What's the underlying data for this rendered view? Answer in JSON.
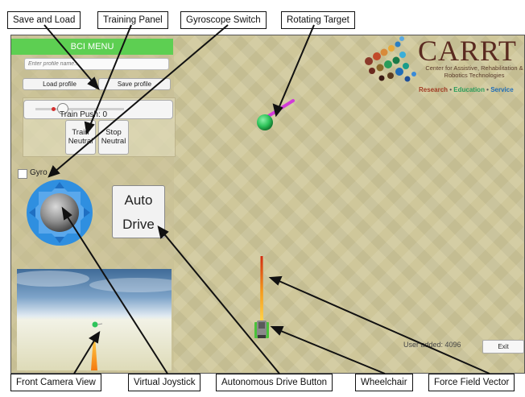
{
  "menu": {
    "title": "BCI MENU"
  },
  "profile": {
    "placeholder": "Enter profile name...",
    "load_label": "Load profile",
    "save_label": "Save profile"
  },
  "training": {
    "push_label": "Train Push: 0",
    "train_neutral_label": "Train\nNeutral",
    "stop_neutral_label": "Stop\nNeutral",
    "slider_value": 0.06
  },
  "gyro": {
    "label": "Gyro",
    "checked": false
  },
  "auto_drive": {
    "line1": "Auto",
    "line2": "Drive"
  },
  "logo": {
    "name": "CARRT",
    "subtitle": "Center for Assistive, Rehabilitation & Robotics Technologies",
    "tag_research": "Research",
    "tag_education": "Education",
    "tag_service": "Service",
    "tag_sep": " • ",
    "colors": {
      "research": "#a23b24",
      "education": "#2a9c5a",
      "service": "#1f6db8"
    }
  },
  "status": {
    "user_added": "User added: 4096"
  },
  "exit": {
    "label": "Exit"
  },
  "callouts": {
    "save_and_load": "Save and Load",
    "training_panel": "Training Panel",
    "gyroscope_switch": "Gyroscope Switch",
    "rotating_target": "Rotating Target",
    "front_camera_view": "Front Camera View",
    "virtual_joystick": "Virtual Joystick",
    "autonomous_drive_button": "Autonomous Drive Button",
    "wheelchair": "Wheelchair",
    "force_field_vector": "Force Field Vector"
  },
  "colors": {
    "menu_green": "#5dcf52",
    "joystick_blue": "#2f8fe0",
    "target_green": "#2ec45a",
    "target_vector": "#d23ad9"
  },
  "icons": [
    "joystick-icon",
    "target-sphere-icon",
    "wheelchair-icon",
    "carrt-logo-icon"
  ]
}
